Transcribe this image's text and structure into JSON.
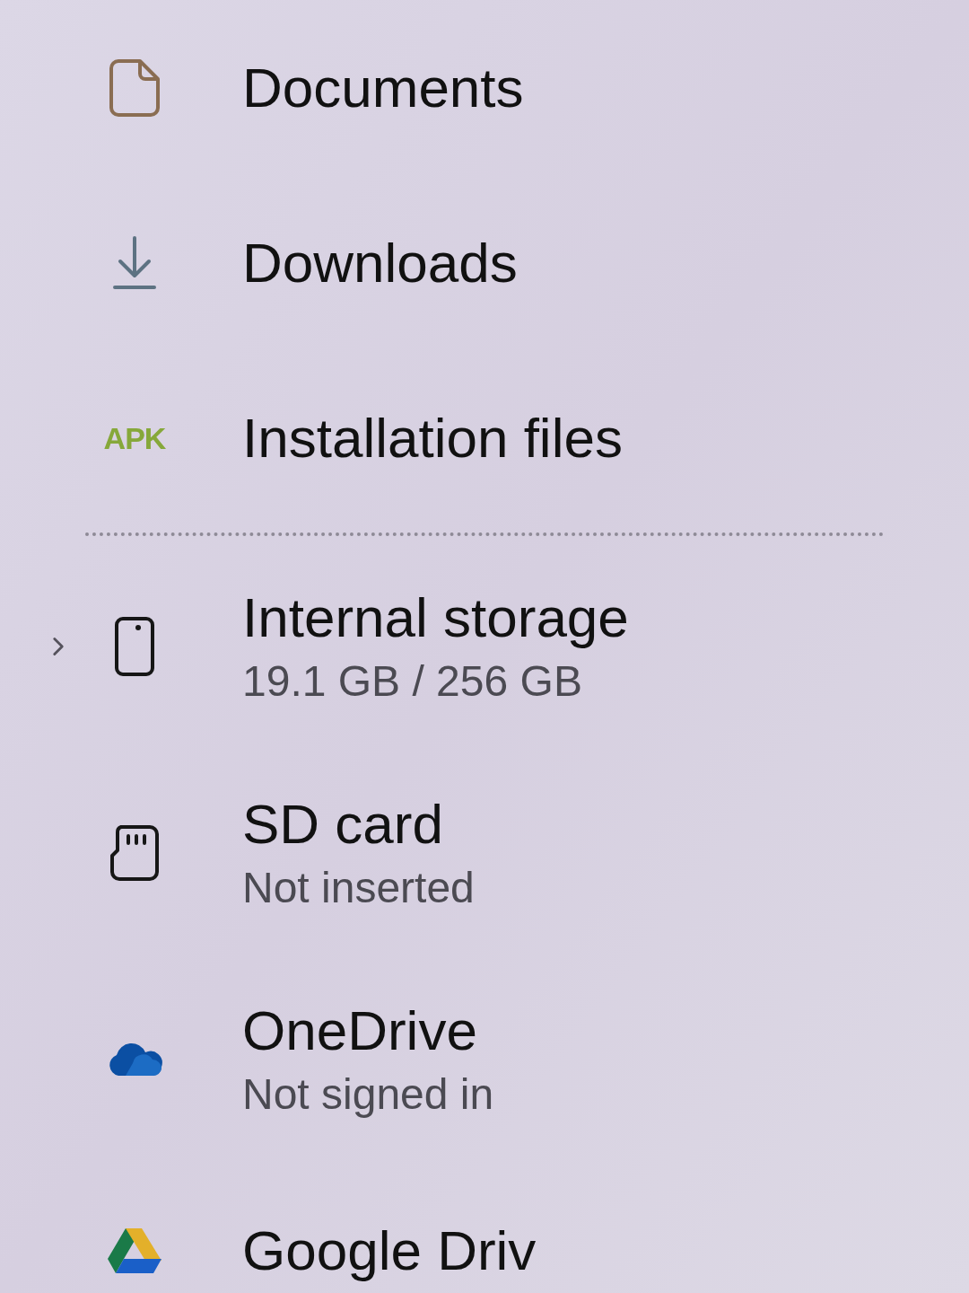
{
  "sections": [
    {
      "items": [
        {
          "kind": "documents",
          "label": "Documents"
        },
        {
          "kind": "downloads",
          "label": "Downloads"
        },
        {
          "kind": "apk",
          "icon_text": "APK",
          "label": "Installation files"
        }
      ]
    },
    {
      "items": [
        {
          "kind": "phone",
          "label": "Internal storage",
          "subtitle": "19.1 GB / 256 GB",
          "expanded": false
        },
        {
          "kind": "sdcard",
          "label": "SD card",
          "subtitle": "Not inserted"
        },
        {
          "kind": "onedrive",
          "label": "OneDrive",
          "subtitle": "Not signed in"
        },
        {
          "kind": "gdrive",
          "label": "Google Driv"
        }
      ]
    }
  ]
}
